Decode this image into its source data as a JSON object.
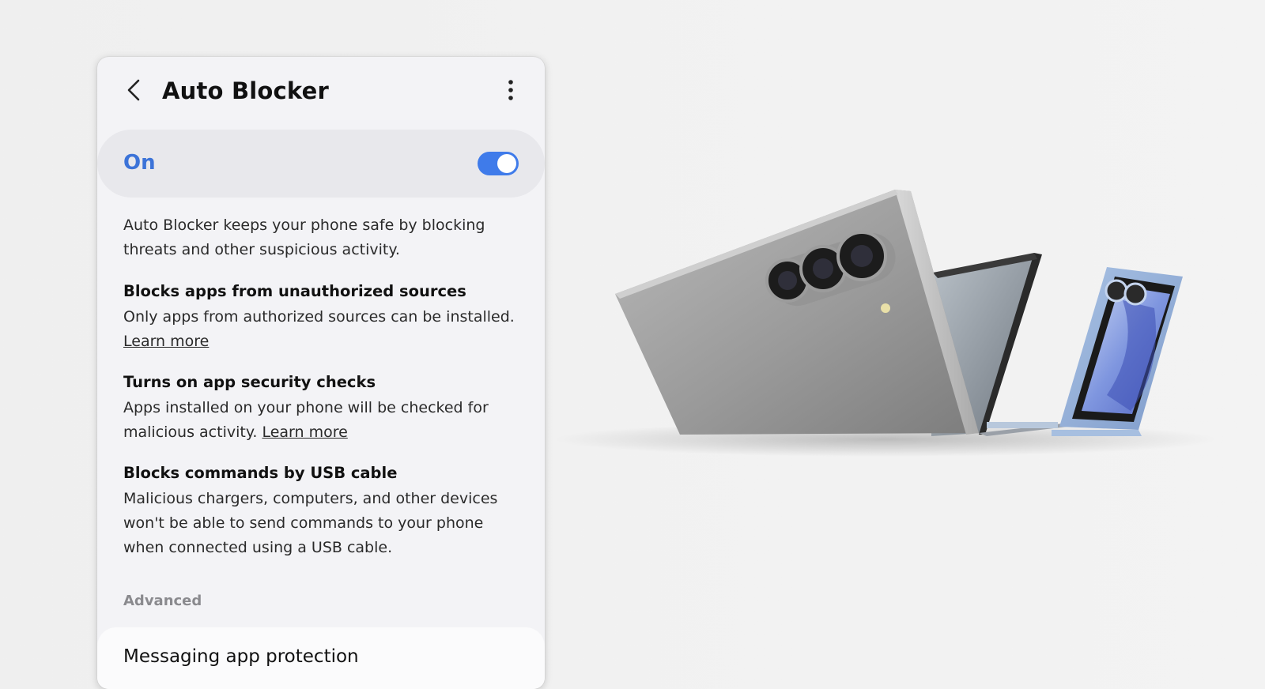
{
  "header": {
    "title": "Auto Blocker",
    "back_icon": "chevron-left-icon",
    "more_icon": "more-vertical-icon"
  },
  "master_toggle": {
    "label": "On",
    "state": "on",
    "accent_color": "#3f7bea"
  },
  "description": "Auto Blocker keeps your phone safe by blocking threats and other suspicious activity.",
  "sections": [
    {
      "title": "Blocks apps from unauthorized sources",
      "body": "Only apps from authorized sources can be installed.",
      "link": "Learn more"
    },
    {
      "title": "Turns on app security checks",
      "body": "Apps installed on your phone will be checked for malicious activity.",
      "link": "Learn more"
    },
    {
      "title": "Blocks commands by USB cable",
      "body": "Malicious chargers, computers, and other devices won't be able to send commands to your phone when connected using a USB cable."
    }
  ],
  "advanced": {
    "label": "Advanced",
    "items": [
      {
        "label": "Messaging app protection"
      }
    ]
  },
  "product_image": {
    "devices": [
      "foldable-phone-gray",
      "flip-phone-blue"
    ]
  }
}
